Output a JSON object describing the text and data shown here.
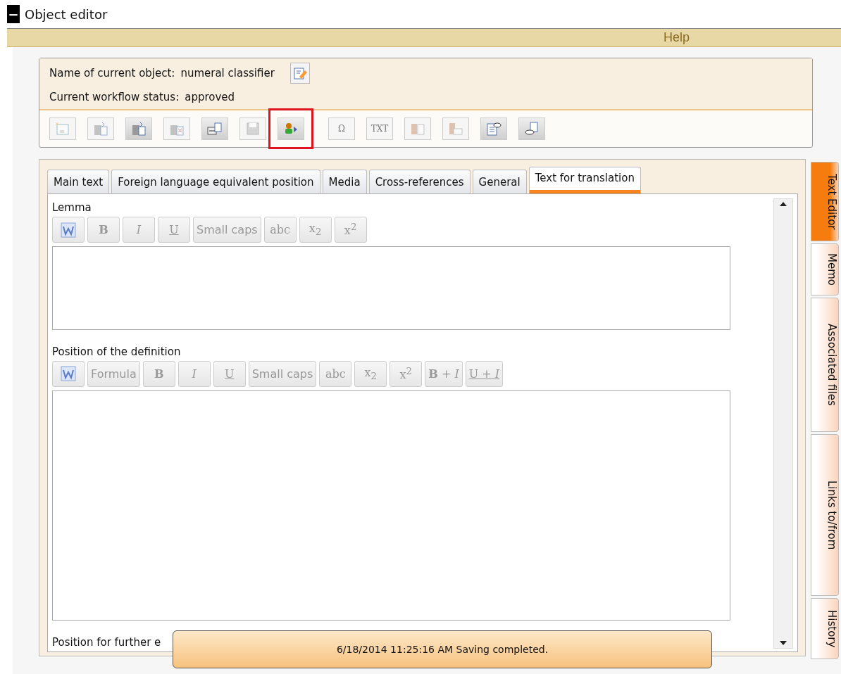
{
  "window": {
    "collapse_glyph": "−",
    "title": "Object editor"
  },
  "help_bar": {
    "label": "Help"
  },
  "object_info": {
    "name_label": "Name of current object:",
    "name_value": "numeral classifier",
    "status_label": "Current workflow status:",
    "status_value": "approved"
  },
  "toolbar": {
    "groups": [
      [
        {
          "disabled": true,
          "highlighted": false
        },
        {
          "disabled": true,
          "highlighted": false
        },
        {
          "disabled": false,
          "highlighted": false
        },
        {
          "disabled": true,
          "highlighted": false
        },
        {
          "disabled": false,
          "highlighted": false
        },
        {
          "disabled": true,
          "highlighted": false
        },
        {
          "disabled": false,
          "highlighted": true
        }
      ],
      [
        {
          "label": "Ω",
          "disabled": true,
          "highlighted": false
        },
        {
          "label": "TXT",
          "disabled": true,
          "highlighted": false
        },
        {
          "disabled": true,
          "highlighted": false
        },
        {
          "disabled": true,
          "highlighted": false
        },
        {
          "disabled": false,
          "highlighted": false
        },
        {
          "disabled": false,
          "highlighted": false
        }
      ]
    ]
  },
  "tabs": [
    {
      "label": "Main text",
      "selected": false
    },
    {
      "label": "Foreign language equivalent position",
      "selected": false
    },
    {
      "label": "Media",
      "selected": false
    },
    {
      "label": "Cross-references",
      "selected": false
    },
    {
      "label": "General",
      "selected": false
    },
    {
      "label": "Text for translation",
      "selected": true
    }
  ],
  "sections": [
    {
      "label": "Lemma",
      "buttons": [
        {
          "kind": "word"
        },
        {
          "kind": "bold",
          "label": "B"
        },
        {
          "kind": "italic",
          "label": "I"
        },
        {
          "kind": "underline",
          "label": "U"
        },
        {
          "kind": "plain",
          "label": "Small caps"
        },
        {
          "kind": "serif",
          "label": "abc"
        },
        {
          "kind": "serif",
          "label": "x$_{2}$"
        },
        {
          "kind": "serif",
          "label": "x$^{2}$"
        }
      ]
    },
    {
      "label": "Position of the definition",
      "buttons": [
        {
          "kind": "word"
        },
        {
          "kind": "plain",
          "label": "Formula"
        },
        {
          "kind": "bold",
          "label": "B"
        },
        {
          "kind": "italic",
          "label": "I"
        },
        {
          "kind": "underline",
          "label": "U"
        },
        {
          "kind": "plain",
          "label": "Small caps"
        },
        {
          "kind": "serif",
          "label": "abc"
        },
        {
          "kind": "serif",
          "label": "x$_{2}$"
        },
        {
          "kind": "serif",
          "label": "x$^{2}$"
        },
        {
          "kind": "bolditalic",
          "label": "**B** + *I*"
        },
        {
          "kind": "underitalic",
          "label": "U + *I*"
        }
      ]
    },
    {
      "label": "Position for further e"
    }
  ],
  "side_tabs": [
    {
      "label": "Text Editor",
      "selected": true
    },
    {
      "label": "Memo",
      "selected": false
    },
    {
      "label": "Associated files",
      "selected": false
    },
    {
      "label": "Links to/from",
      "selected": false
    },
    {
      "label": "History",
      "selected": false
    }
  ],
  "toast": {
    "message": "6/18/2014 11:25:16 AM Saving completed."
  }
}
